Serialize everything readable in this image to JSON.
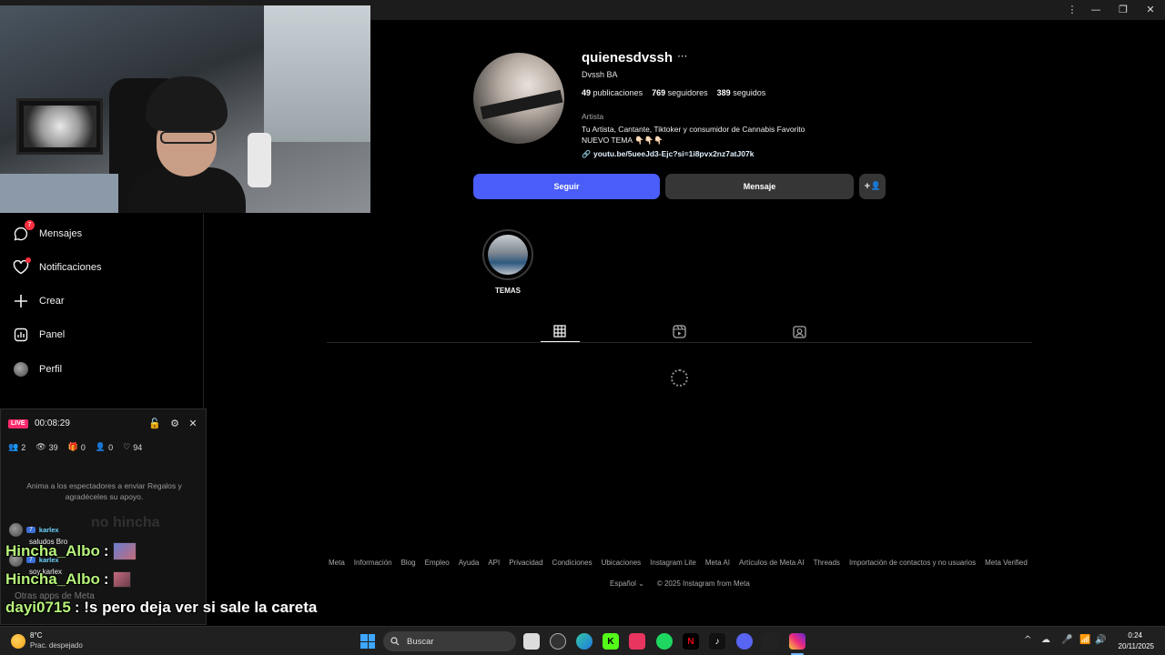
{
  "window": {
    "controls": [
      "⋮",
      "—",
      "❐",
      "✕"
    ]
  },
  "sidebar": {
    "items": [
      {
        "label": "Mensajes",
        "icon": "messenger-icon",
        "badge": "7"
      },
      {
        "label": "Notificaciones",
        "icon": "heart-icon"
      },
      {
        "label": "Crear",
        "icon": "plus-icon"
      },
      {
        "label": "Panel",
        "icon": "chart-icon"
      },
      {
        "label": "Perfil",
        "icon": "avatar"
      }
    ]
  },
  "live": {
    "badge": "LIVE",
    "timer": "00:08:29",
    "stats": [
      "2",
      "39",
      "0",
      "0",
      "94"
    ],
    "hint": "Anima a los espectadores a enviar Regalos y agradéceles su apoyo.",
    "chat": [
      {
        "level": "7",
        "user": "karlex",
        "message": "saludos Bro"
      },
      {
        "level": "7",
        "user": "karlex",
        "message": "soy karlex"
      }
    ],
    "ghost_text": "no hincha",
    "input_placeholder": "Otras apps de Meta"
  },
  "overlay_chat": [
    {
      "user": "Hincha_Albo",
      "message": ":"
    },
    {
      "user": "Hincha_Albo",
      "message": ":"
    },
    {
      "user": "dayi0715",
      "message": ": !s pero deja ver si sale la careta"
    }
  ],
  "profile": {
    "username": "quienesdvssh",
    "more": "···",
    "full_name": "Dvssh BA",
    "posts_count": "49",
    "posts_label": "publicaciones",
    "followers_count": "769",
    "followers_label": "seguidores",
    "following_count": "389",
    "following_label": "seguidos",
    "category": "Artista",
    "bio_line1": "Tu Artista, Cantante, Tiktoker y consumidor de Cannabis Favorito",
    "bio_line2": "NUEVO TEMA 👇🏻👇🏻👇🏻",
    "link": "youtu.be/5ueeJd3-Ejc?si=1i8pvx2nz7atJ07k",
    "follow_button": "Seguir",
    "message_button": "Mensaje",
    "suggest_button": "+👤",
    "highlight_label": "TEMAS"
  },
  "footer": {
    "links": [
      "Meta",
      "Información",
      "Blog",
      "Empleo",
      "Ayuda",
      "API",
      "Privacidad",
      "Condiciones",
      "Ubicaciones",
      "Instagram Lite",
      "Meta AI",
      "Artículos de Meta AI",
      "Threads",
      "Importación de contactos y no usuarios",
      "Meta Verified"
    ],
    "language": "Español",
    "copyright": "© 2025 Instagram from Meta"
  },
  "taskbar": {
    "weather_temp": "8°C",
    "weather_desc": "Prac. despejado",
    "search_placeholder": "Buscar",
    "tray_icons": [
      "^",
      "☁",
      "🎤",
      "📶",
      "🔊"
    ],
    "time": "0:24",
    "date": "20/11/2025"
  },
  "colors": {
    "accent": "#4a5df9",
    "badge": "#ff3040",
    "live": "#ff2a6d",
    "overlay_name": "#b6f27a"
  }
}
